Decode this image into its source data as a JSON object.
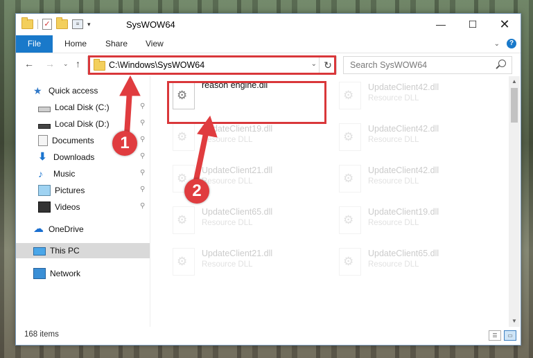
{
  "window": {
    "title": "SysWOW64",
    "minimize_glyph": "—",
    "maximize_glyph": "☐",
    "close_glyph": "✕"
  },
  "ribbon": {
    "tabs": [
      "File",
      "Home",
      "Share",
      "View"
    ],
    "collapse_glyph": "⌄",
    "help_glyph": "?"
  },
  "navbar": {
    "back_glyph": "←",
    "forward_glyph": "→",
    "recent_glyph": "⌄",
    "up_glyph": "↑",
    "address": "C:\\Windows\\SysWOW64",
    "address_dropdown_glyph": "⌄",
    "refresh_glyph": "↻",
    "search_placeholder": "Search SysWOW64"
  },
  "nav_pane": {
    "items": [
      {
        "label": "Quick access",
        "icon": "star-icon",
        "pinned": false
      },
      {
        "label": "Local Disk (C:)",
        "icon": "disk-icon",
        "pinned": true
      },
      {
        "label": "Local Disk (D:)",
        "icon": "disk-icon",
        "pinned": true
      },
      {
        "label": "Documents",
        "icon": "documents-icon",
        "pinned": true
      },
      {
        "label": "Downloads",
        "icon": "download-icon",
        "pinned": true
      },
      {
        "label": "Music",
        "icon": "music-icon",
        "pinned": true
      },
      {
        "label": "Pictures",
        "icon": "pictures-icon",
        "pinned": true
      },
      {
        "label": "Videos",
        "icon": "videos-icon",
        "pinned": true
      },
      {
        "label": "OneDrive",
        "icon": "cloud-icon",
        "pinned": false
      },
      {
        "label": "This PC",
        "icon": "computer-icon",
        "pinned": false,
        "selected": true
      },
      {
        "label": "Network",
        "icon": "network-icon",
        "pinned": false
      }
    ],
    "pin_glyph": "📌"
  },
  "files": {
    "featured": {
      "name": "reason engine.dll",
      "type": ""
    },
    "items": [
      {
        "name": "UpdateClient42.dll",
        "type": "Resource DLL"
      },
      {
        "name": "UpdateClient19.dll",
        "type": "Resource DLL"
      },
      {
        "name": "UpdateClient42.dll",
        "type": "Resource DLL"
      },
      {
        "name": "UpdateClient21.dll",
        "type": "Resource DLL"
      },
      {
        "name": "UpdateClient42.dll",
        "type": "Resource DLL"
      },
      {
        "name": "UpdateClient65.dll",
        "type": "Resource DLL"
      },
      {
        "name": "UpdateClient19.dll",
        "type": "Resource DLL"
      },
      {
        "name": "UpdateClient21.dll",
        "type": "Resource DLL"
      },
      {
        "name": "UpdateClient65.dll",
        "type": "Resource DLL"
      }
    ]
  },
  "status": {
    "item_count": "168 items"
  },
  "annotations": {
    "badge_1": "1",
    "badge_2": "2",
    "color": "#e03c3f"
  }
}
